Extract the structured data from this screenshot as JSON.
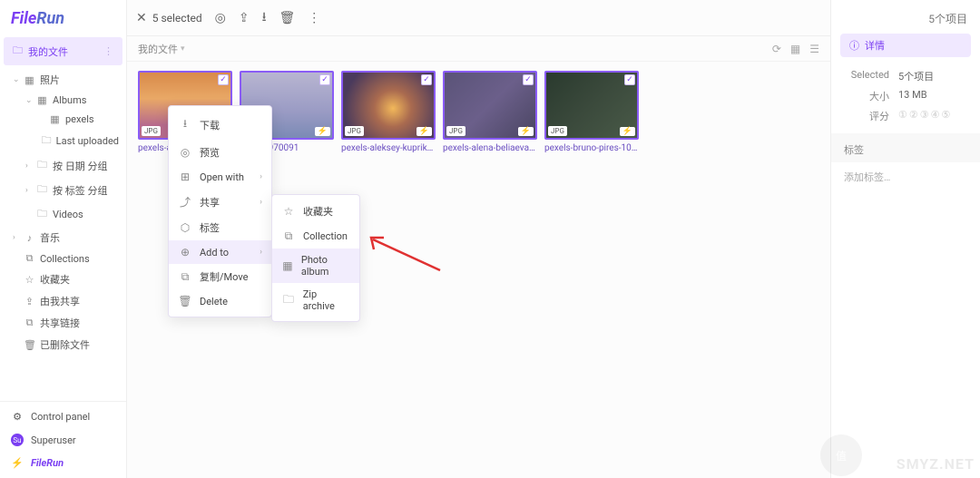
{
  "logo": {
    "part1": "File",
    "part2": "Run"
  },
  "sidebar": {
    "myFiles": "我的文件",
    "tree": [
      {
        "label": "照片",
        "icon": "▦",
        "level": 1,
        "chev": "⌄"
      },
      {
        "label": "Albums",
        "icon": "▦",
        "level": 2,
        "chev": "⌄"
      },
      {
        "label": "pexels",
        "icon": "▦",
        "level": 3,
        "chev": ""
      },
      {
        "label": "Last uploaded",
        "icon": "🗀",
        "level": 3,
        "chev": ""
      },
      {
        "label": "按 日期 分组",
        "icon": "🗀",
        "level": 2,
        "chev": "›"
      },
      {
        "label": "按 标签 分组",
        "icon": "🗀",
        "level": 2,
        "chev": "›"
      },
      {
        "label": "Videos",
        "icon": "🗀",
        "level": 2,
        "chev": ""
      },
      {
        "label": "音乐",
        "icon": "♪",
        "level": 1,
        "chev": "›"
      },
      {
        "label": "Collections",
        "icon": "⧉",
        "level": 1,
        "chev": ""
      },
      {
        "label": "收藏夹",
        "icon": "☆",
        "level": 1,
        "chev": ""
      },
      {
        "label": "由我共享",
        "icon": "⇪",
        "level": 1,
        "chev": ""
      },
      {
        "label": "共享链接",
        "icon": "⧉",
        "level": 1,
        "chev": ""
      },
      {
        "label": "已删除文件",
        "icon": "🗑",
        "level": 1,
        "chev": ""
      }
    ],
    "bottom": {
      "controlPanel": "Control panel",
      "superuser": "Superuser",
      "brand": "FileRun"
    }
  },
  "toolbar": {
    "selected": "5 selected"
  },
  "breadcrumb": {
    "path": "我的文件"
  },
  "thumbs": [
    {
      "name": "pexels-adi-p…",
      "badge": "JPG"
    },
    {
      "name": "…ed-10970091",
      "badge": "JPG"
    },
    {
      "name": "pexels-aleksey-kuprikov-…",
      "badge": "JPG"
    },
    {
      "name": "pexels-alena-beliaeva-95…",
      "badge": "JPG"
    },
    {
      "name": "pexels-bruno-pires-1016…",
      "badge": "JPG"
    }
  ],
  "contextMenu": [
    {
      "icon": "⭳",
      "label": "下载"
    },
    {
      "icon": "◎",
      "label": "预览"
    },
    {
      "icon": "⊞",
      "label": "Open with",
      "sub": true
    },
    {
      "icon": "⤴",
      "label": "共享",
      "sub": true
    },
    {
      "icon": "⬡",
      "label": "标签"
    },
    {
      "icon": "⊕",
      "label": "Add to",
      "sub": true,
      "hl": true
    },
    {
      "icon": "⧉",
      "label": "复制/Move"
    },
    {
      "icon": "🗑",
      "label": "Delete"
    }
  ],
  "subMenu": [
    {
      "icon": "☆",
      "label": "收藏夹"
    },
    {
      "icon": "⧉",
      "label": "Collection"
    },
    {
      "icon": "▦",
      "label": "Photo album",
      "hl": true
    },
    {
      "icon": "🗀",
      "label": "Zip archive"
    }
  ],
  "rightPanel": {
    "title": "5个项目",
    "detailBtn": "详情",
    "rows": [
      {
        "k": "Selected",
        "v": "5个项目"
      },
      {
        "k": "大小",
        "v": "13 MB"
      },
      {
        "k": "评分",
        "v": "①②③④⑤"
      }
    ],
    "tagSection": "标签",
    "addTag": "添加标签…"
  },
  "watermark": {
    "text": "SMYZ.NET",
    "badge": "值"
  }
}
